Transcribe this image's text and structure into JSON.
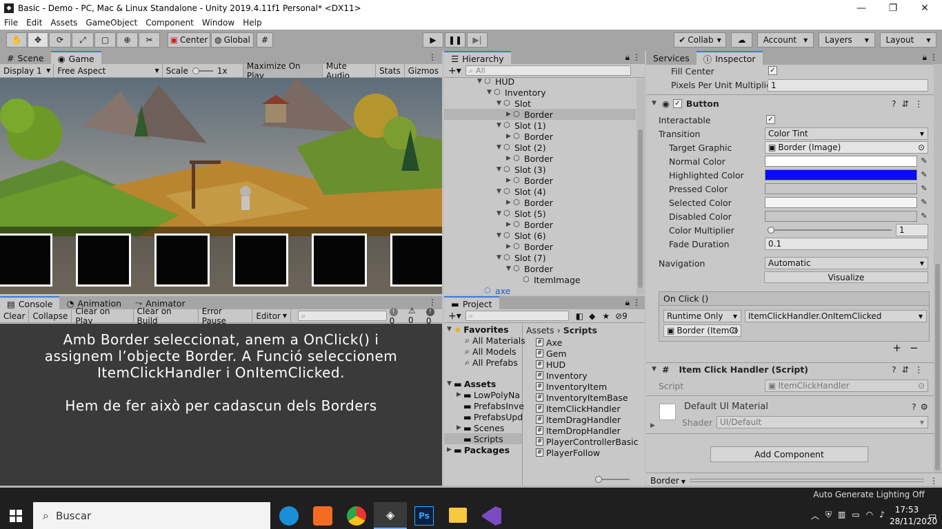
{
  "window": {
    "title": "Basic - Demo - PC, Mac & Linux Standalone - Unity 2019.4.11f1 Personal* <DX11>"
  },
  "menu": [
    "File",
    "Edit",
    "Assets",
    "GameObject",
    "Component",
    "Window",
    "Help"
  ],
  "toolbar": {
    "center": "Center",
    "global": "Global",
    "collab": "Collab",
    "account": "Account",
    "layers": "Layers",
    "layout": "Layout"
  },
  "scene_panel": {
    "tabs": [
      "Scene",
      "Game"
    ],
    "display": "Display 1",
    "aspect": "Free Aspect",
    "scale_label": "Scale",
    "scale_value": "1x",
    "buttons": [
      "Maximize On Play",
      "Mute Audio",
      "Stats",
      "Gizmos"
    ],
    "slots": 6
  },
  "hierarchy": {
    "tab": "Hierarchy",
    "search_placeholder": "All",
    "rows": [
      {
        "label": "HUD",
        "indent": 0,
        "tri": "▼"
      },
      {
        "label": "Inventory",
        "indent": 1,
        "tri": "▼"
      },
      {
        "label": "Slot",
        "indent": 2,
        "tri": "▼"
      },
      {
        "label": "Border",
        "indent": 3,
        "tri": "▶",
        "selected": true
      },
      {
        "label": "Slot (1)",
        "indent": 2,
        "tri": "▼"
      },
      {
        "label": "Border",
        "indent": 3,
        "tri": "▶"
      },
      {
        "label": "Slot (2)",
        "indent": 2,
        "tri": "▼"
      },
      {
        "label": "Border",
        "indent": 3,
        "tri": "▶"
      },
      {
        "label": "Slot (3)",
        "indent": 2,
        "tri": "▼"
      },
      {
        "label": "Border",
        "indent": 3,
        "tri": "▶"
      },
      {
        "label": "Slot (4)",
        "indent": 2,
        "tri": "▼"
      },
      {
        "label": "Border",
        "indent": 3,
        "tri": "▶"
      },
      {
        "label": "Slot (5)",
        "indent": 2,
        "tri": "▼"
      },
      {
        "label": "Border",
        "indent": 3,
        "tri": "▶"
      },
      {
        "label": "Slot (6)",
        "indent": 2,
        "tri": "▼"
      },
      {
        "label": "Border",
        "indent": 3,
        "tri": "▶"
      },
      {
        "label": "Slot (7)",
        "indent": 2,
        "tri": "▼"
      },
      {
        "label": "Border",
        "indent": 3,
        "tri": "▼"
      },
      {
        "label": "ItemImage",
        "indent": 4,
        "tri": ""
      },
      {
        "label": "axe",
        "indent": 0,
        "tri": "",
        "blue": true
      }
    ]
  },
  "console": {
    "tabs": [
      "Console",
      "Animation",
      "Animator"
    ],
    "buttons": [
      "Clear",
      "Collapse",
      "Clear on Play",
      "Clear on Build",
      "Error Pause",
      "Editor"
    ],
    "counts": [
      "0",
      "0",
      "0"
    ],
    "note_line1": "Amb Border seleccionat, anem a OnClick() i",
    "note_line2": "assignem l’objecte Border. A Funció seleccionem",
    "note_line3": "ItemClickHandler i OnItemClicked.",
    "note_line4": "Hem de fer això per cadascun dels Borders"
  },
  "project": {
    "tab": "Project",
    "hidden_count": "9",
    "favorites_label": "Favorites",
    "favorites": [
      "All Materials",
      "All Models",
      "All Prefabs"
    ],
    "assets_label": "Assets",
    "folders": [
      "LowPolyNa",
      "PrefabsInve",
      "PrefabsUpd",
      "Scenes",
      "Scripts"
    ],
    "packages_label": "Packages",
    "breadcrumb_root": "Assets",
    "breadcrumb_current": "Scripts",
    "scripts": [
      "Axe",
      "Gem",
      "HUD",
      "Inventory",
      "InventoryItem",
      "InventoryItemBase",
      "ItemClickHandler",
      "ItemDragHandler",
      "ItemDropHandler",
      "PlayerControllerBasic",
      "PlayerFollow"
    ]
  },
  "inspector": {
    "tabs": [
      "Services",
      "Inspector"
    ],
    "fill_center": "Fill Center",
    "ppu_label": "Pixels Per Unit Multiplier",
    "ppu_value": "1",
    "button_header": "Button",
    "interactable": "Interactable",
    "transition_label": "Transition",
    "transition_value": "Color Tint",
    "target_graphic_label": "Target Graphic",
    "target_graphic_value": "Border (Image)",
    "normal_color": "Normal Color",
    "highlighted_color": "Highlighted Color",
    "pressed_color": "Pressed Color",
    "selected_color": "Selected Color",
    "disabled_color": "Disabled Color",
    "color_multiplier_label": "Color Multiplier",
    "color_multiplier_value": "1",
    "fade_label": "Fade Duration",
    "fade_value": "0.1",
    "navigation_label": "Navigation",
    "navigation_value": "Automatic",
    "visualize": "Visualize",
    "onclick_label": "On Click ()",
    "runtime": "Runtime Only",
    "function": "ItemClickHandler.OnItemClicked",
    "object": "Border (ItemCl",
    "plus": "+",
    "minus": "−",
    "script_header": "Item Click Handler (Script)",
    "script_label": "Script",
    "script_value": "ItemClickHandler",
    "material_name": "Default UI Material",
    "shader_label": "Shader",
    "shader_value": "UI/Default",
    "add_component": "Add Component",
    "footer_label": "Border",
    "colors": {
      "normal": "#ffffff",
      "highlighted": "#0a0af5",
      "pressed": "#c8c8c8",
      "selected": "#f5f5f5",
      "disabled": "#c8c8c8"
    }
  },
  "taskbar": {
    "search_placeholder": "Buscar",
    "notice": "Auto Generate Lighting Off",
    "time": "17:53",
    "date": "28/11/2020"
  }
}
